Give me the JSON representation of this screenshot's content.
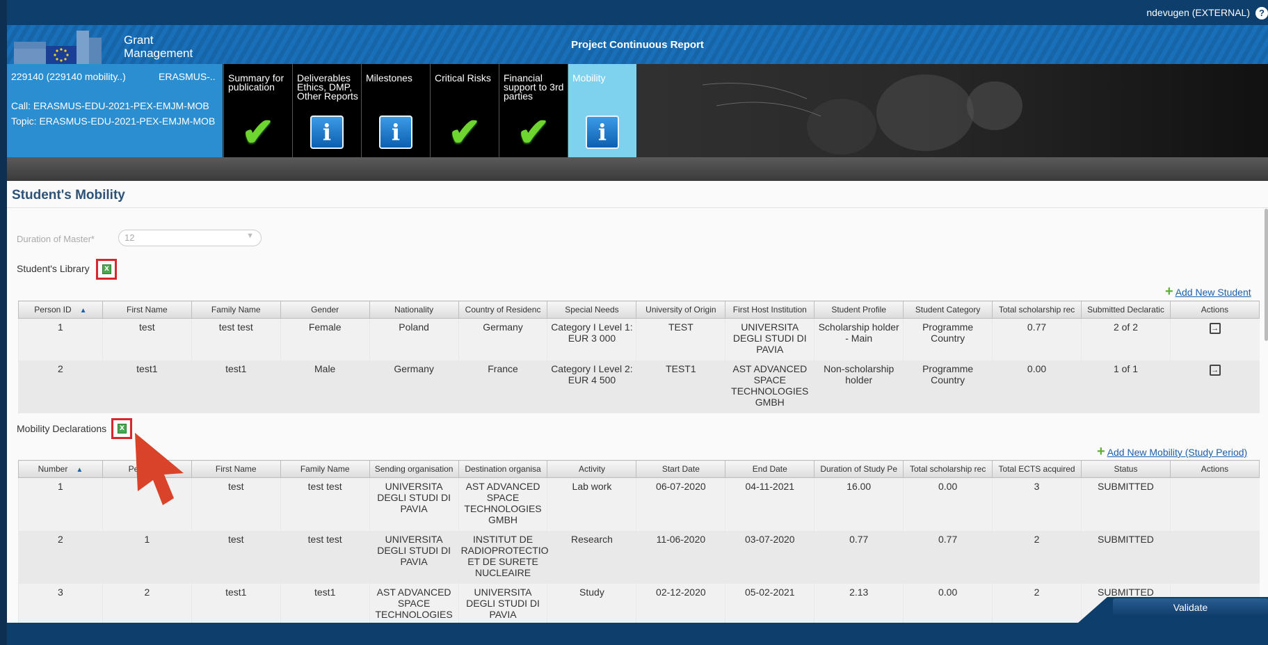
{
  "header": {
    "user": "ndevugen (EXTERNAL)",
    "help_label": "?",
    "brand_line1": "Grant",
    "brand_line2": "Management",
    "page_title": "Project Continuous Report"
  },
  "project": {
    "id": "229140 (229140 mobility..)",
    "programme": "ERASMUS-..",
    "call": "Call: ERASMUS-EDU-2021-PEX-EMJM-MOB",
    "topic": "Topic: ERASMUS-EDU-2021-PEX-EMJM-MOB"
  },
  "tabs": [
    {
      "label": "Summary for publication",
      "icon": "check-icon",
      "active": false
    },
    {
      "label": "Deliverables Ethics, DMP, Other Reports",
      "icon": "info-icon",
      "active": false
    },
    {
      "label": "Milestones",
      "icon": "info-icon",
      "active": false
    },
    {
      "label": "Critical Risks",
      "icon": "check-icon",
      "active": false
    },
    {
      "label": "Financial support to 3rd parties",
      "icon": "check-icon",
      "active": false
    },
    {
      "label": "Mobility",
      "icon": "info-icon",
      "active": true
    }
  ],
  "section": {
    "title": "Student's Mobility",
    "duration_label": "Duration of Master*",
    "duration_value": "12",
    "library_label": "Student's Library",
    "add_student": "Add New Student",
    "mobility_label": "Mobility Declarations",
    "add_mobility": "Add New Mobility (Study Period)"
  },
  "students": {
    "columns": [
      "Person ID",
      "First Name",
      "Family Name",
      "Gender",
      "Nationality",
      "Country of Residenc",
      "Special Needs",
      "University of Origin",
      "First Host Institution",
      "Student Profile",
      "Student Category",
      "Total scholarship rec",
      "Submitted Declaratic",
      "Actions"
    ],
    "rows": [
      [
        "1",
        "test",
        "test test",
        "Female",
        "Poland",
        "Germany",
        "Category I Level 1: EUR 3 000",
        "TEST",
        "UNIVERSITA DEGLI STUDI DI PAVIA",
        "Scholarship holder - Main",
        "Programme Country",
        "0.77",
        "2 of 2"
      ],
      [
        "2",
        "test1",
        "test1",
        "Male",
        "Germany",
        "France",
        "Category I Level 2: EUR 4 500",
        "TEST1",
        "AST ADVANCED SPACE TECHNOLOGIES GMBH",
        "Non-scholarship holder",
        "Programme Country",
        "0.00",
        "1 of 1"
      ]
    ]
  },
  "mobility": {
    "columns": [
      "Number",
      "Person ID",
      "First Name",
      "Family Name",
      "Sending organisation",
      "Destination organisa",
      "Activity",
      "Start Date",
      "End Date",
      "Duration of Study Pe",
      "Total scholarship rec",
      "Total ECTS acquired",
      "Status",
      "Actions"
    ],
    "rows": [
      [
        "1",
        "",
        "test",
        "test test",
        "UNIVERSITA DEGLI STUDI DI PAVIA",
        "AST ADVANCED SPACE TECHNOLOGIES GMBH",
        "Lab work",
        "06-07-2020",
        "04-11-2021",
        "16.00",
        "0.00",
        "3",
        "SUBMITTED"
      ],
      [
        "2",
        "1",
        "test",
        "test test",
        "UNIVERSITA DEGLI STUDI DI PAVIA",
        "INSTITUT DE RADIOPROTECTIO ET DE SURETE NUCLEAIRE",
        "Research",
        "11-06-2020",
        "03-07-2020",
        "0.77",
        "0.77",
        "2",
        "SUBMITTED"
      ],
      [
        "3",
        "2",
        "test1",
        "test1",
        "AST ADVANCED SPACE TECHNOLOGIES",
        "UNIVERSITA DEGLI STUDI DI PAVIA",
        "Study",
        "02-12-2020",
        "05-02-2021",
        "2.13",
        "0.00",
        "2",
        "SUBMITTED"
      ]
    ]
  },
  "footer": {
    "validate": "Validate"
  },
  "colors": {
    "topbar": "#0e3e6b",
    "project_panel": "#2b8ed1",
    "active_tab": "#7fd2ee",
    "highlight_box": "#d8262e",
    "pointer_arrow": "#d9432a"
  }
}
